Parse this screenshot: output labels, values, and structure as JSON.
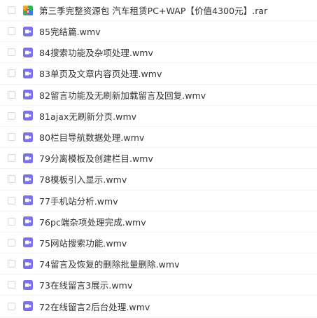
{
  "colors": {
    "video_icon": "#7b72e8",
    "archive_green": "#35b35e",
    "archive_orange": "#f5a623",
    "archive_red": "#e8473c",
    "archive_blue": "#3f7ee8",
    "text": "#333333",
    "checkbox_border": "#d7d7d7"
  },
  "files": [
    {
      "name": "第三季完整资源包 汽车租赁PC+WAP【价值4300元】.rar",
      "icon": "archive-icon"
    },
    {
      "name": "85完结篇.wmv",
      "icon": "video-icon"
    },
    {
      "name": "84搜索功能及杂项处理.wmv",
      "icon": "video-icon"
    },
    {
      "name": "83单页及文章内容页处理.wmv",
      "icon": "video-icon"
    },
    {
      "name": "82留言功能及无刷新加载留言及回复.wmv",
      "icon": "video-icon"
    },
    {
      "name": "81ajax无刷新分页.wmv",
      "icon": "video-icon"
    },
    {
      "name": "80栏目导航数据处理.wmv",
      "icon": "video-icon"
    },
    {
      "name": "79分离模板及创建栏目.wmv",
      "icon": "video-icon"
    },
    {
      "name": "78模板引入显示.wmv",
      "icon": "video-icon"
    },
    {
      "name": "77手机站分析.wmv",
      "icon": "video-icon"
    },
    {
      "name": "76pc端杂项处理完成.wmv",
      "icon": "video-icon"
    },
    {
      "name": "75网站搜索功能.wmv",
      "icon": "video-icon"
    },
    {
      "name": "74留言及恢复的删除批量删除.wmv",
      "icon": "video-icon"
    },
    {
      "name": "73在线留言3展示.wmv",
      "icon": "video-icon"
    },
    {
      "name": "72在线留言2后台处理.wmv",
      "icon": "video-icon"
    }
  ]
}
